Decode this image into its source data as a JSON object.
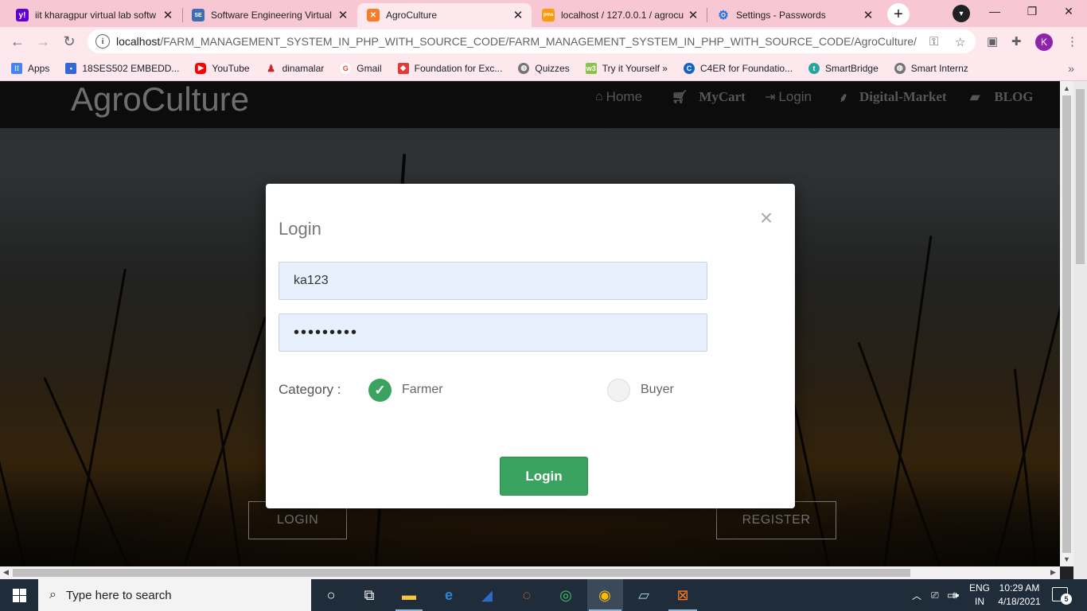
{
  "browser": {
    "tabs": [
      {
        "title": "iit kharagpur virtual lab softw",
        "icon": "yahoo-icon",
        "color": "#6001d2",
        "glyph": "y!"
      },
      {
        "title": "Software Engineering Virtual",
        "icon": "vlab-icon",
        "color": "#3b6db3",
        "glyph": "SE"
      },
      {
        "title": "AgroCulture",
        "icon": "xampp-icon",
        "color": "#fb7a24",
        "glyph": "✕"
      },
      {
        "title": "localhost / 127.0.0.1 / agrocu",
        "icon": "phpmyadmin-icon",
        "color": "#f89c0e",
        "glyph": "pma"
      },
      {
        "title": "Settings - Passwords",
        "icon": "gear-icon",
        "color": "#1a73e8",
        "glyph": "⚙"
      }
    ],
    "active_tab": 2,
    "url_host": "localhost",
    "url_path": "/FARM_MANAGEMENT_SYSTEM_IN_PHP_WITH_SOURCE_CODE/FARM_MANAGEMENT_SYSTEM_IN_PHP_WITH_SOURCE_CODE/AgroCulture/",
    "profile_initial": "K",
    "bookmarks": [
      {
        "label": "Apps",
        "color": "#4285f4"
      },
      {
        "label": "18SES502 EMBEDD...",
        "color": "#3367d6"
      },
      {
        "label": "YouTube",
        "color": "#ff0000"
      },
      {
        "label": "dinamalar",
        "color": "#c62828"
      },
      {
        "label": "Gmail",
        "color": "#ea4335"
      },
      {
        "label": "Foundation for Exc...",
        "color": "#e53935"
      },
      {
        "label": "Quizzes",
        "color": "#757575"
      },
      {
        "label": "Try it Yourself »",
        "color": "#8bc34a"
      },
      {
        "label": "C4ER for Foundatio...",
        "color": "#1565c0"
      },
      {
        "label": "SmartBridge",
        "color": "#26a69a"
      },
      {
        "label": "Smart Internz",
        "color": "#757575"
      }
    ]
  },
  "site": {
    "logo": "AgroCulture",
    "nav": {
      "home": "Home",
      "mycart": "MyCart",
      "login": "Login",
      "market": "Digital-Market",
      "blog": "BLOG"
    },
    "login_button": "LOGIN",
    "register_button": "REGISTER"
  },
  "modal": {
    "title": "Login",
    "close": "×",
    "username_value": "ka123",
    "password_value": "•••••••••",
    "category_label": "Category :",
    "options": {
      "farmer": "Farmer",
      "buyer": "Buyer"
    },
    "selected": "farmer",
    "submit": "Login"
  },
  "taskbar": {
    "search_placeholder": "Type here to search",
    "lang_line1": "ENG",
    "lang_line2": "IN",
    "time": "10:29 AM",
    "date": "4/18/2021",
    "notifications": "5"
  },
  "colors": {
    "accent_green": "#3aa35f",
    "chrome_tabstrip": "#f7c7d3",
    "chrome_toolbar": "#fde8ee",
    "taskbar": "#1f2d3a"
  }
}
